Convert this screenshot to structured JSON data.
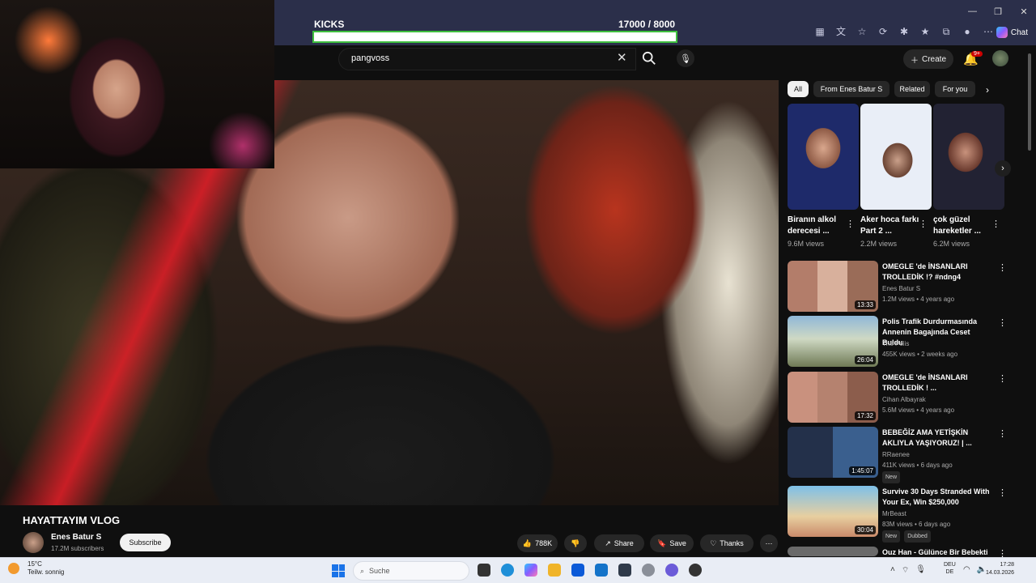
{
  "overlay": {
    "kicks_label": "KICKS",
    "kicks_count": "17000 / 8000",
    "kicks_progress": 1.0
  },
  "browser": {
    "chat_label": "Chat",
    "window_controls": [
      "—",
      "❐",
      "✕"
    ]
  },
  "header": {
    "search_value": "pangvoss",
    "create_label": "Create",
    "notification_count": "9+"
  },
  "video": {
    "title": "HAYATTAYIM VLOG",
    "channel": "Enes Batur S",
    "subscribers": "17.2M subscribers",
    "subscribe_label": "Subscribe",
    "likes": "788K",
    "share_label": "Share",
    "save_label": "Save",
    "thanks_label": "Thanks"
  },
  "chips": [
    "All",
    "From Enes Batur S",
    "Related",
    "For you"
  ],
  "shorts": [
    {
      "title": "Biranın alkol derecesi ...",
      "views": "9.6M views"
    },
    {
      "title": "Aker hoca farkı Part 2 ...",
      "views": "2.2M views"
    },
    {
      "title": "çok güzel hareketler ...",
      "views": "6.2M views"
    }
  ],
  "videos": [
    {
      "title": "OMEGLE 'de İNSANLARI TROLLEDİK !? #ndng4",
      "channel": "Enes Batur S",
      "meta": "1.2M views • 4 years ago",
      "duration": "13:33",
      "tags": []
    },
    {
      "title": "Polis Trafik Durdurmasında Annenin Bagajında Ceset Buldu",
      "channel": "The Polis",
      "meta": "455K views • 2 weeks ago",
      "duration": "26:04",
      "tags": []
    },
    {
      "title": "OMEGLE 'de İNSANLARI TROLLEDİK ! ...",
      "channel": "Cihan Albayrak",
      "meta": "5.6M views • 4 years ago",
      "duration": "17:32",
      "tags": []
    },
    {
      "title": "BEBEĞİZ AMA YETİŞKİN AKLIYLA YAŞIYORUZ! | ...",
      "channel": "RRaenee",
      "meta": "411K views • 6 days ago",
      "duration": "1:45:07",
      "tags": [
        "New"
      ]
    },
    {
      "title": "Survive 30 Days Stranded With Your Ex, Win $250,000",
      "channel": "MrBeast",
      "meta": "83M views • 6 days ago",
      "duration": "30:04",
      "tags": [
        "New",
        "Dubbed"
      ]
    },
    {
      "title": "Ouz Han - Gülünce Bir Bebekti",
      "channel": "",
      "meta": "",
      "duration": "",
      "tags": []
    }
  ],
  "taskbar": {
    "weather_temp": "15°C",
    "weather_desc": "Teilw. sonnig",
    "search_placeholder": "Suche",
    "lang_top": "DEU",
    "lang_bottom": "DE",
    "time": "17:28",
    "date": "14.03.2026"
  },
  "colors": {
    "accent_green": "#3fbf3f",
    "yt_bg": "#0f0f0f",
    "badge_red": "#cc0000"
  }
}
